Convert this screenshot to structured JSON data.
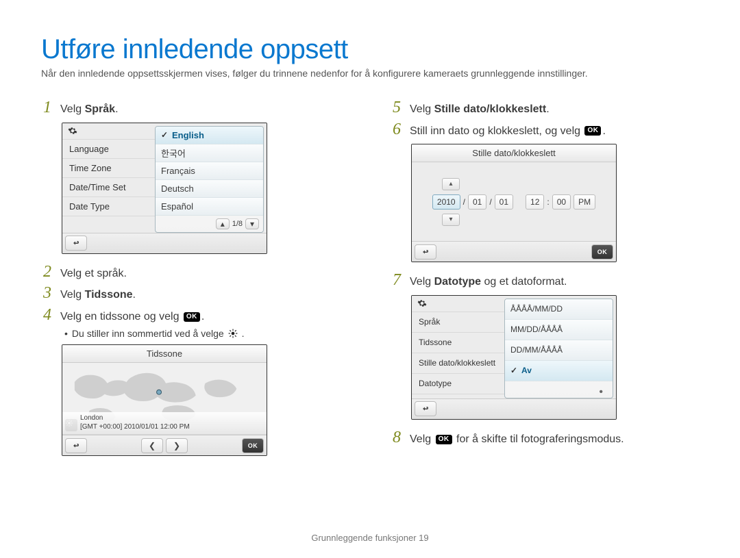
{
  "title": "Utføre innledende oppsett",
  "intro": "Når den innledende oppsettsskjermen vises, følger du trinnene nedenfor for å konfigurere kameraets grunnleggende innstillinger.",
  "ok_label": "OK",
  "steps": {
    "s1_pre": "Velg ",
    "s1_bold": "Språk",
    "s1_post": ".",
    "s2": "Velg et språk.",
    "s3_pre": "Velg ",
    "s3_bold": "Tidssone",
    "s3_post": ".",
    "s4_pre": "Velg en tidssone og velg ",
    "s4_post": ".",
    "s4_sub": "Du stiller inn sommertid ved å velge ",
    "s5_pre": "Velg ",
    "s5_bold": "Stille dato/klokkeslett",
    "s5_post": ".",
    "s6_pre": "Still inn dato og klokkeslett, og velg ",
    "s6_post": ".",
    "s7_pre": "Velg ",
    "s7_bold": "Datotype",
    "s7_post": " og et datoformat.",
    "s8_pre": "Velg ",
    "s8_post": " for å skifte til fotograferingsmodus."
  },
  "lang_screen": {
    "left": [
      "Language",
      "Time Zone",
      "Date/Time Set",
      "Date Type"
    ],
    "right": [
      "English",
      "한국어",
      "Français",
      "Deutsch",
      "Español"
    ],
    "selected_index": 0,
    "pager": "1/8"
  },
  "tz_screen": {
    "title": "Tidssone",
    "city": "London",
    "detail": "[GMT +00:00] 2010/01/01 12:00 PM"
  },
  "dt_screen": {
    "title": "Stille dato/klokkeslett",
    "year": "2010",
    "mon": "01",
    "day": "01",
    "hour": "12",
    "min": "00",
    "ampm": "PM",
    "sep_date": "/",
    "sep_time": ":"
  },
  "datetype_screen": {
    "left": [
      "Språk",
      "Tidssone",
      "Stille dato/klokkeslett",
      "Datotype"
    ],
    "right": [
      "ÅÅÅÅ/MM/DD",
      "MM/DD/ÅÅÅÅ",
      "DD/MM/ÅÅÅÅ",
      "Av"
    ],
    "selected_index": 3
  },
  "footer": "Grunnleggende funksjoner  19"
}
